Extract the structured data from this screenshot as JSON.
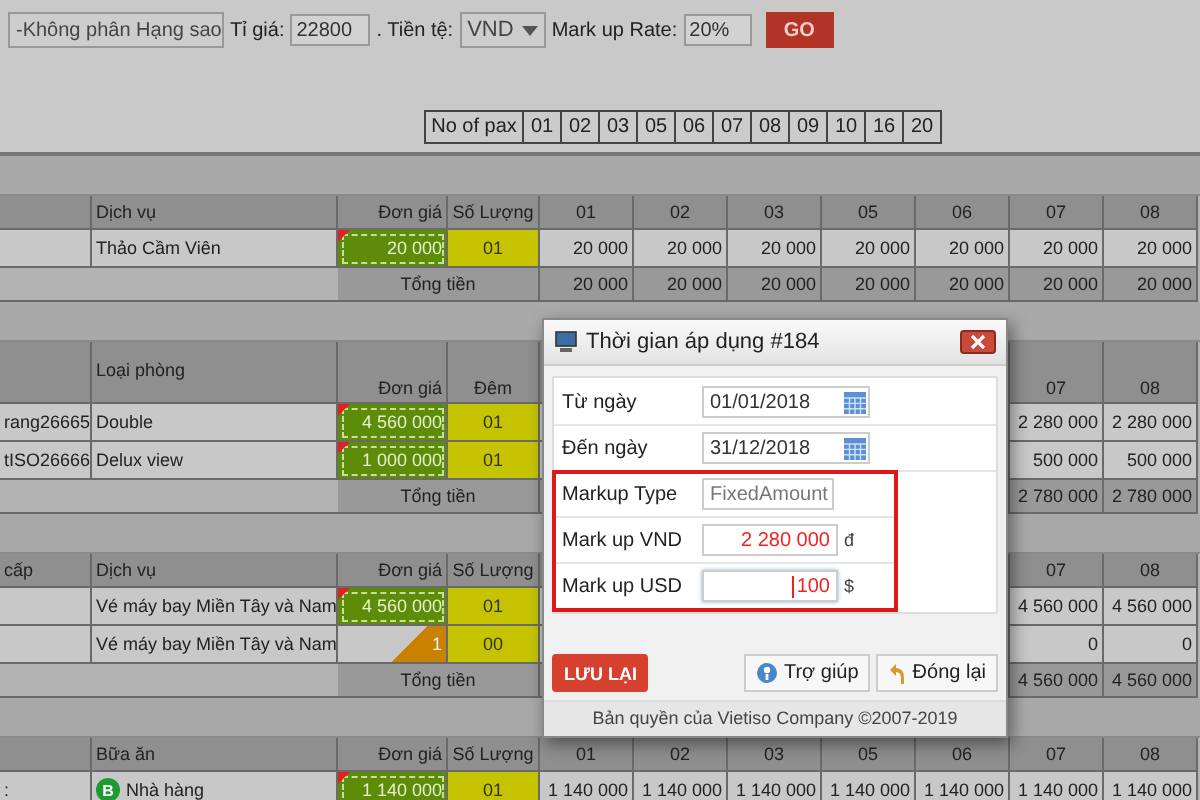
{
  "toolbar": {
    "star_filter": "-Không phân Hạng sao",
    "rate_label": "Tỉ giá:",
    "rate": "22800",
    "currency_label": ". Tiền tệ:",
    "currency": "VND",
    "markup_label": "Mark up Rate:",
    "markup_rate": "20%",
    "go_button": "GO"
  },
  "pax_selector": {
    "label": "No of pax",
    "options": [
      "01",
      "02",
      "03",
      "05",
      "06",
      "07",
      "08",
      "09",
      "10",
      "16",
      "20"
    ]
  },
  "sections": [
    {
      "kind": "service",
      "header": {
        "name": "Dịch vụ",
        "price": "Đơn giá",
        "qty": "Số Lượng",
        "pax": [
          "01",
          "02",
          "03",
          "05",
          "06",
          "07",
          "08"
        ]
      },
      "rows": [
        {
          "name": "Thảo Cầm Viên",
          "price": "20 000",
          "kind": "edited",
          "qty": "01",
          "values": [
            "20 000",
            "20 000",
            "20 000",
            "20 000",
            "20 000",
            "20 000",
            "20 000"
          ]
        }
      ],
      "total": {
        "label": "Tổng tiền",
        "values": [
          "20 000",
          "20 000",
          "20 000",
          "20 000",
          "20 000",
          "20 000",
          "20 000"
        ]
      }
    },
    {
      "kind": "room",
      "header": {
        "name": "Loại phòng",
        "price": "Đơn giá",
        "qty": "Đêm",
        "pax": [
          "07",
          "08"
        ]
      },
      "rows": [
        {
          "code": "rang26665",
          "name": "Double",
          "price": "4 560 000",
          "kind": "edited",
          "qty": "01",
          "values": [
            "2 280 000",
            "2 280 000"
          ]
        },
        {
          "code": "tISO26666",
          "name": "Delux view",
          "price": "1 000 000",
          "kind": "edited",
          "qty": "01",
          "values": [
            "500 000",
            "500 000"
          ]
        }
      ],
      "total": {
        "label": "Tổng tiền",
        "values": [
          "2 780 000",
          "2 780 000"
        ]
      }
    },
    {
      "kind": "service",
      "header": {
        "code": "cấp",
        "name": "Dịch vụ",
        "price": "Đơn giá",
        "qty": "Số Lượng",
        "pax": [
          "07",
          "08"
        ]
      },
      "rows": [
        {
          "name": "Vé máy bay Miền Tây và Nam",
          "price": "4 560 000",
          "kind": "edited",
          "qty": "01",
          "values": [
            "4 560 000",
            "4 560 000"
          ]
        },
        {
          "name": "Vé máy bay Miền Tây và Nam",
          "price": "1",
          "kind": "partial",
          "qty": "00",
          "values": [
            "0",
            "0"
          ]
        }
      ],
      "total": {
        "label": "Tổng tiền",
        "values": [
          "4 560 000",
          "4 560 000"
        ]
      }
    },
    {
      "kind": "service",
      "header": {
        "name": "Bữa ăn",
        "price": "Đơn giá",
        "qty": "Số Lượng",
        "pax": [
          "01",
          "02",
          "03",
          "05",
          "06",
          "07",
          "08"
        ]
      },
      "rows": [
        {
          "code": ":",
          "badge": "B",
          "name": "Nhà hàng",
          "price": "1 140 000",
          "kind": "edited",
          "qty": "01",
          "values": [
            "1 140 000",
            "1 140 000",
            "1 140 000",
            "1 140 000",
            "1 140 000",
            "1 140 000",
            "1 140 000"
          ]
        }
      ]
    }
  ],
  "dialog": {
    "title": "Thời gian áp dụng #184",
    "fields": [
      {
        "kind": "date",
        "label": "Từ ngày",
        "value": "01/01/2018",
        "highlighted": false,
        "focused": false
      },
      {
        "kind": "date",
        "label": "Đến ngày",
        "value": "31/12/2018",
        "highlighted": false,
        "focused": false
      },
      {
        "kind": "select",
        "label": "Markup Type",
        "value": "FixedAmount",
        "highlighted": true,
        "focused": false
      },
      {
        "kind": "amount",
        "label": "Mark up VND",
        "value": "2 280 000",
        "unit": "đ",
        "highlighted": true,
        "focused": false
      },
      {
        "kind": "amount",
        "label": "Mark up USD",
        "value": "100",
        "unit": "$",
        "highlighted": true,
        "focused": true
      }
    ],
    "save_button": "LƯU LẠI",
    "help_button": "Trợ giúp",
    "close_button": "Đóng lại",
    "copyright": "Bản quyền của Vietiso Company ©2007-2019"
  }
}
